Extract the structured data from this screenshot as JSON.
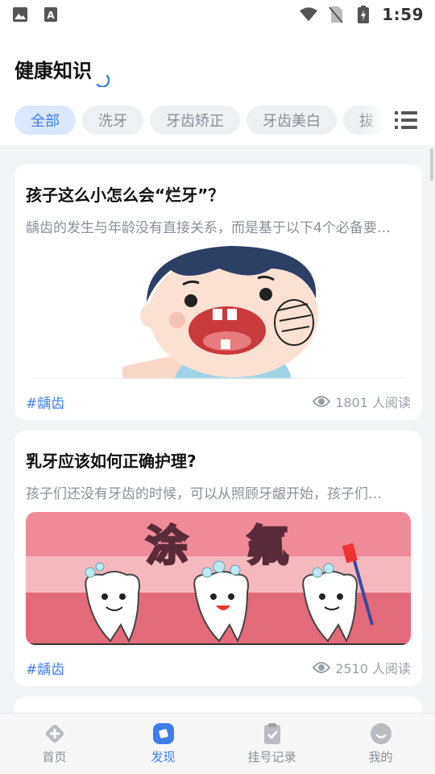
{
  "status_bar": {
    "time": "1:59"
  },
  "header": {
    "title": "健康知识"
  },
  "tabs": [
    {
      "label": "全部",
      "active": true
    },
    {
      "label": "洗牙",
      "active": false
    },
    {
      "label": "牙齿矫正",
      "active": false
    },
    {
      "label": "牙齿美白",
      "active": false
    },
    {
      "label": "拔",
      "active": false
    }
  ],
  "articles": [
    {
      "title": "孩子这么小怎么会“烂牙”？",
      "summary": "龋齿的发生与年龄没有直接关系，而是基于以下4个必备要…",
      "tag": "#龋齿",
      "views": "1801 人阅读"
    },
    {
      "title": "乳牙应该如何正确护理?",
      "summary": "孩子们还没有牙齿的时候，可以从照顾牙龈开始，孩子们…",
      "tag": "#龋齿",
      "views": "2510 人阅读",
      "image_text": [
        "涂",
        "氟"
      ]
    }
  ],
  "bottom_nav": [
    {
      "label": "首页",
      "icon": "home-icon",
      "active": false
    },
    {
      "label": "发现",
      "icon": "discover-icon",
      "active": true
    },
    {
      "label": "挂号记录",
      "icon": "clipboard-check-icon",
      "active": false
    },
    {
      "label": "我的",
      "icon": "profile-icon",
      "active": false
    }
  ],
  "colors": {
    "accent": "#3f7ee8",
    "tab_active_bg": "#dbe7fb",
    "card_bg": "#ffffff",
    "page_bg": "#f3f4f6"
  }
}
